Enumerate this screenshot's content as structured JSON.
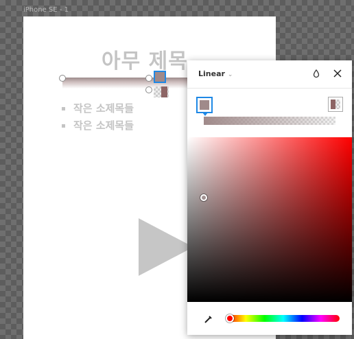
{
  "canvas": {
    "frame_label": "iPhone SE - 1",
    "slide_title": "아무 제목",
    "bullets": [
      "작은 소제목들",
      "작은 소제목들"
    ]
  },
  "gradient_editor": {
    "type_label": "Linear",
    "type_chevron_icon": "chevron-down-icon",
    "style_icon": "drop-icon",
    "close_icon": "close-icon",
    "stop_color": "#a08a8a",
    "end_stop_color": "#8d6565",
    "hue_color": "#ff0000",
    "eyedropper_icon": "eyedropper-icon"
  }
}
